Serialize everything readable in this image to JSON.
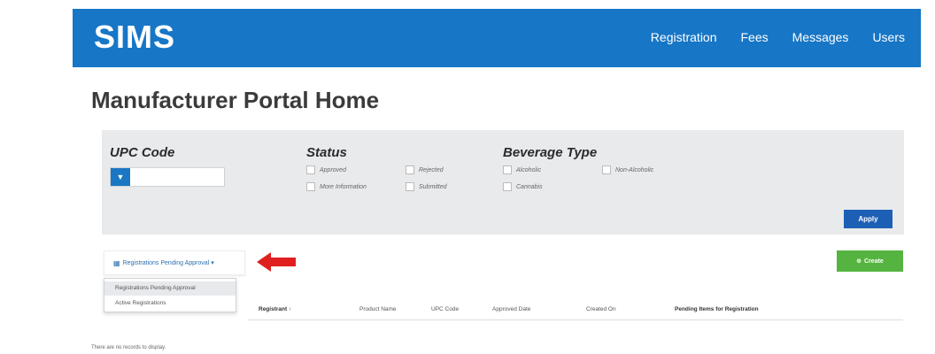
{
  "app": {
    "logo": "SIMS",
    "nav": [
      "Registration",
      "Fees",
      "Messages",
      "Users"
    ]
  },
  "page_title": "Manufacturer Portal Home",
  "filters": {
    "upc": {
      "label": "UPC Code",
      "button_icon": "▼",
      "value": ""
    },
    "status": {
      "label": "Status",
      "options": [
        "Approved",
        "Rejected",
        "More Information",
        "Submitted"
      ]
    },
    "beverage": {
      "label": "Beverage Type",
      "options": [
        "Alcoholic",
        "Non-Alcoholic",
        "Cannabis"
      ]
    },
    "apply_label": "Apply"
  },
  "toolbar": {
    "view_label": "Registrations Pending Approval",
    "view_icon": "grid-icon",
    "create_label": "Create",
    "create_icon": "plus-circle-icon"
  },
  "dropdown": {
    "items": [
      "Registrations Pending Approval",
      "Active Registrations"
    ]
  },
  "table": {
    "columns": [
      "Registrant",
      "Product Name",
      "UPC Code",
      "Approved Date",
      "Created On",
      "Pending Items for Registration"
    ],
    "sort_indicator": "↑",
    "empty_text": "There are no records to display."
  },
  "colors": {
    "topbar": "#1776c6",
    "apply": "#1d5fb5",
    "create": "#55b43f",
    "arrow": "#e02020"
  }
}
